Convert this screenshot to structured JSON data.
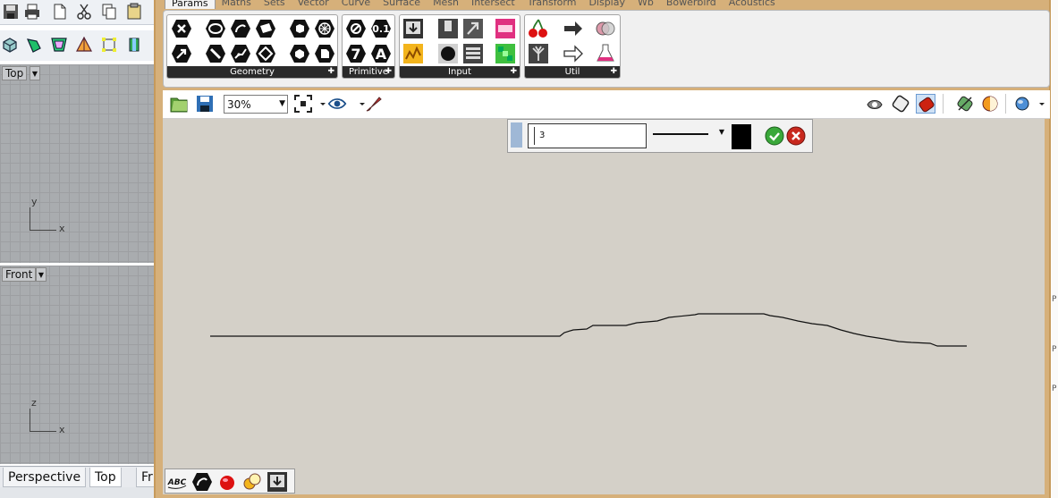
{
  "rhino": {
    "viewports": [
      {
        "label": "Top",
        "axis_a": "y",
        "axis_b": "x"
      },
      {
        "label": "Front",
        "axis_a": "z",
        "axis_b": "x"
      }
    ],
    "tabs": [
      "Perspective",
      "Top",
      "Fr"
    ]
  },
  "gh": {
    "tabs": [
      "Params",
      "Maths",
      "Sets",
      "Vector",
      "Curve",
      "Surface",
      "Mesh",
      "Intersect",
      "Transform",
      "Display",
      "Wb",
      "Bowerbird",
      "Acoustics"
    ],
    "active_tab": "Params",
    "panels": [
      {
        "label": "Geometry"
      },
      {
        "label": "Primitive",
        "number_label": "0.1",
        "integer_label": "7",
        "text_label": "A"
      },
      {
        "label": "Input"
      },
      {
        "label": "Util"
      }
    ],
    "toolbar": {
      "zoom": "30%"
    },
    "preview": {
      "thickness": "3"
    },
    "widget_text": "ABC",
    "right_marks": [
      "P",
      "P",
      "P"
    ]
  },
  "colors": {
    "canvas": "#d4d0c8",
    "window_frame": "#d6b07a",
    "panel_footer": "#2a2a2a",
    "ok_green": "#3aa83a",
    "cancel_red": "#c8281e"
  }
}
